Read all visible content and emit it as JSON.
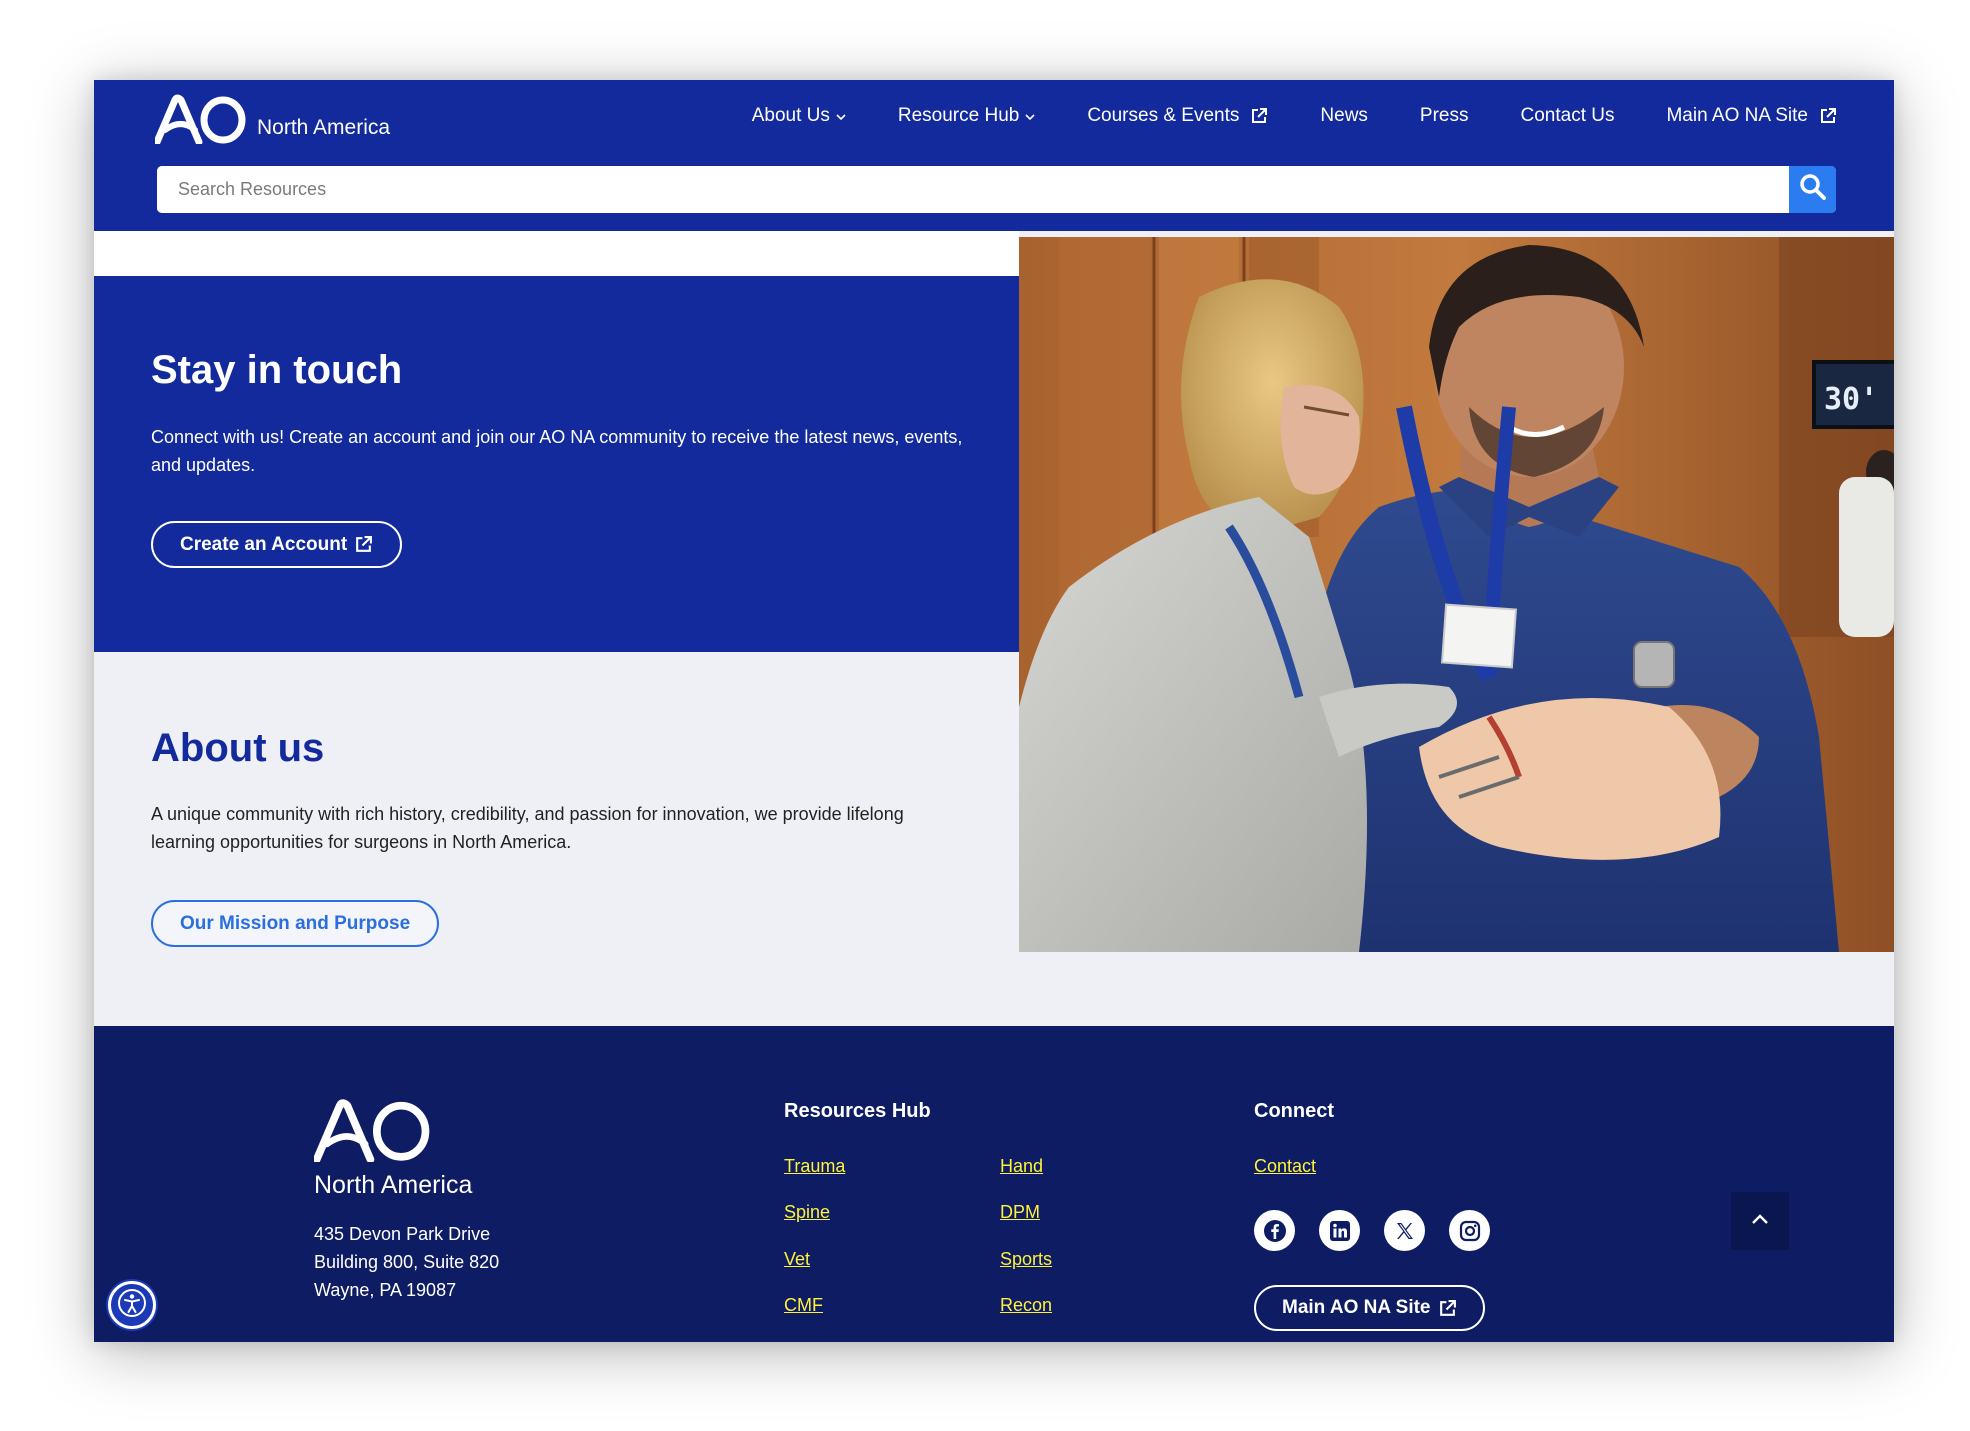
{
  "header": {
    "logo_text": "AO",
    "logo_subtitle": "North America",
    "nav": [
      {
        "label": "About Us",
        "icon": "chevron-down-icon"
      },
      {
        "label": "Resource Hub",
        "icon": "chevron-down-icon"
      },
      {
        "label": "Courses & Events",
        "icon": "external-link-icon"
      },
      {
        "label": "News"
      },
      {
        "label": "Press"
      },
      {
        "label": "Contact Us"
      },
      {
        "label": "Main AO NA Site",
        "icon": "external-link-icon"
      }
    ],
    "search_placeholder": "Search Resources"
  },
  "stay_in_touch": {
    "title": "Stay in touch",
    "text": "Connect with us! Create an account and join our AO NA community to receive the latest news, events, and updates.",
    "button": "Create an Account"
  },
  "about": {
    "title": "About us",
    "text": "A unique community with rich history, credibility, and passion for innovation, we provide lifelong learning opportunities for surgeons in North America.",
    "button": "Our Mission and Purpose"
  },
  "photo": {
    "screen_text": "30'"
  },
  "footer": {
    "logo_text": "AO",
    "logo_subtitle": "North America",
    "address": [
      "435 Devon Park Drive",
      "Building 800, Suite 820",
      "Wayne, PA 19087"
    ],
    "resources_title": "Resources Hub",
    "resources_col1": [
      "Trauma",
      "Spine",
      "Vet",
      "CMF"
    ],
    "resources_col2": [
      "Hand",
      "DPM",
      "Sports",
      "Recon"
    ],
    "connect_title": "Connect",
    "connect_link": "Contact",
    "social": [
      "facebook-icon",
      "linkedin-icon",
      "x-icon",
      "instagram-icon"
    ],
    "main_site_button": "Main AO NA Site"
  },
  "colors": {
    "brand_blue": "#122a9c",
    "footer_navy": "#0d1c63",
    "link_yellow": "#fff23a",
    "accent_blue": "#2b7cf0"
  }
}
